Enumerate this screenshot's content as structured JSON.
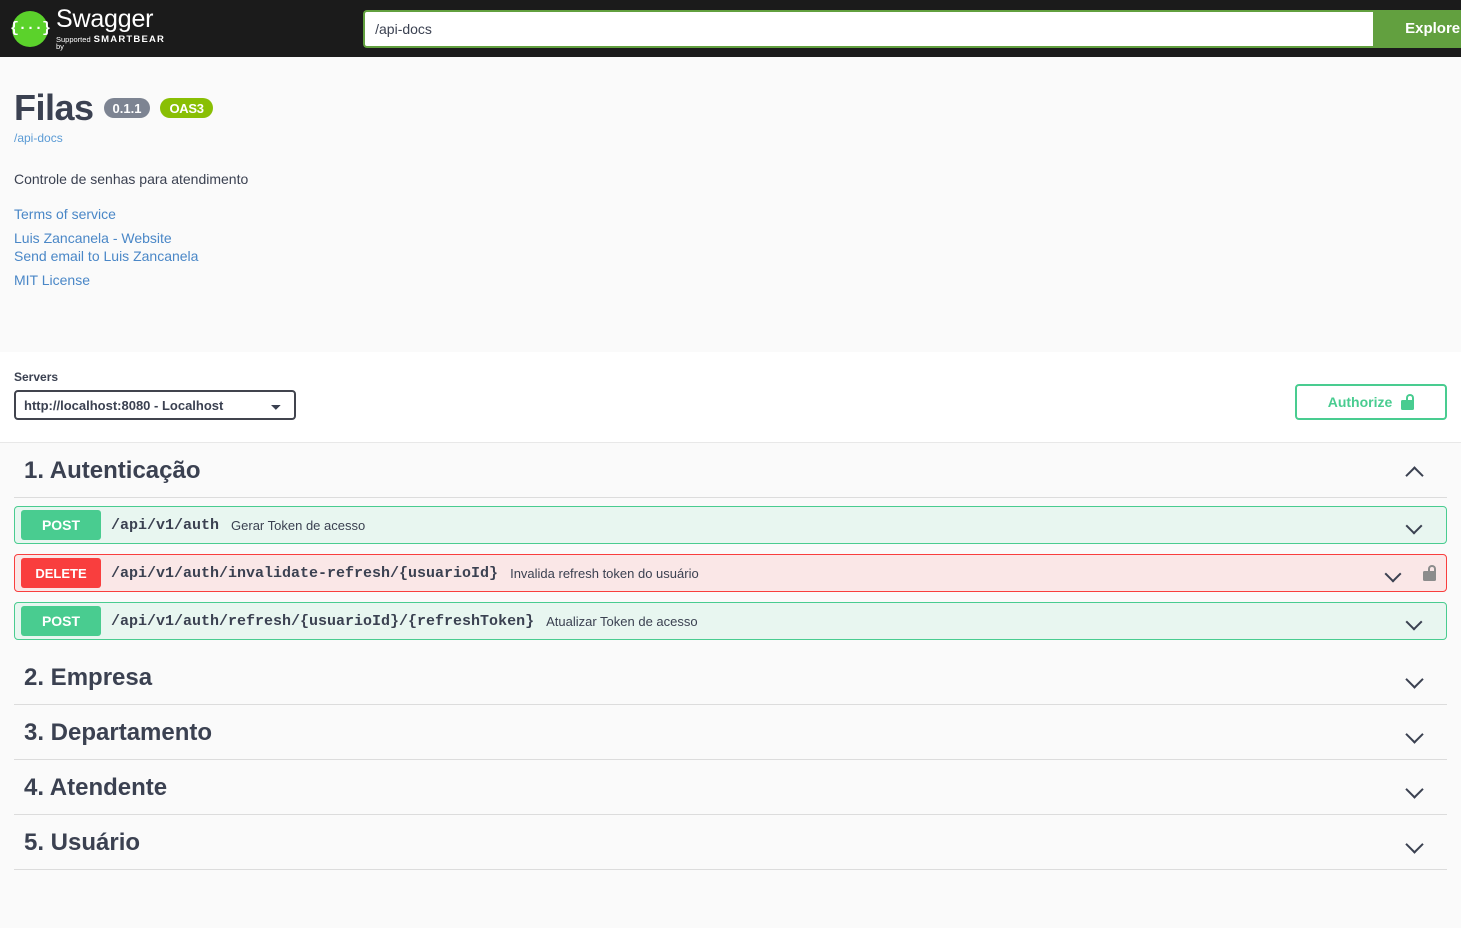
{
  "topbar": {
    "logo_title": "Swagger",
    "logo_supported_prefix": "Supported by",
    "logo_supported_brand": "SMARTBEAR",
    "logo_glyph": "{···}",
    "search_value": "/api-docs",
    "search_placeholder": "Explore",
    "explore_label": "Explore"
  },
  "info": {
    "title": "Filas",
    "version_badge": "0.1.1",
    "oas_badge": "OAS3",
    "url": "/api-docs",
    "description": "Controle de senhas para atendimento",
    "links": [
      {
        "label": "Terms of service"
      },
      {
        "label": "Luis Zancanela - Website"
      },
      {
        "label": "Send email to Luis Zancanela"
      },
      {
        "label": "MIT License"
      }
    ]
  },
  "servers": {
    "label": "Servers",
    "selected": "http://localhost:8080 - Localhost",
    "options": [
      "http://localhost:8080 - Localhost"
    ],
    "authorize_label": "Authorize",
    "authorize_icon": "unlocked-padlock-icon"
  },
  "sections": [
    {
      "title": "1. Autenticação",
      "expanded": true,
      "chevron": "chevron-up-icon",
      "operations": [
        {
          "method": "POST",
          "path": "/api/v1/auth",
          "summary": "Gerar Token de acesso",
          "locked": false,
          "chevron": "chevron-down-icon"
        },
        {
          "method": "DELETE",
          "path": "/api/v1/auth/invalidate-refresh/{usuarioId}",
          "summary": "Invalida refresh token do usuário",
          "locked": true,
          "chevron": "chevron-down-icon"
        },
        {
          "method": "POST",
          "path": "/api/v1/auth/refresh/{usuarioId}/{refreshToken}",
          "summary": "Atualizar Token de acesso",
          "locked": false,
          "chevron": "chevron-down-icon"
        }
      ]
    },
    {
      "title": "2. Empresa",
      "expanded": false,
      "chevron": "chevron-down-icon",
      "operations": []
    },
    {
      "title": "3. Departamento",
      "expanded": false,
      "chevron": "chevron-down-icon",
      "operations": []
    },
    {
      "title": "4. Atendente",
      "expanded": false,
      "chevron": "chevron-down-icon",
      "operations": []
    },
    {
      "title": "5. Usuário",
      "expanded": false,
      "chevron": "chevron-down-icon",
      "operations": []
    }
  ],
  "colors": {
    "topbar_bg": "#1b1b1b",
    "explore_green": "#62a03f",
    "logo_green": "#5bd22b",
    "oas_green": "#89bf04",
    "version_gray": "#7d8492",
    "post_green": "#49cc90",
    "delete_red": "#f93e3e",
    "link_blue": "#4a87c7",
    "text_dark": "#3b4151",
    "page_bg": "#fafafa"
  }
}
